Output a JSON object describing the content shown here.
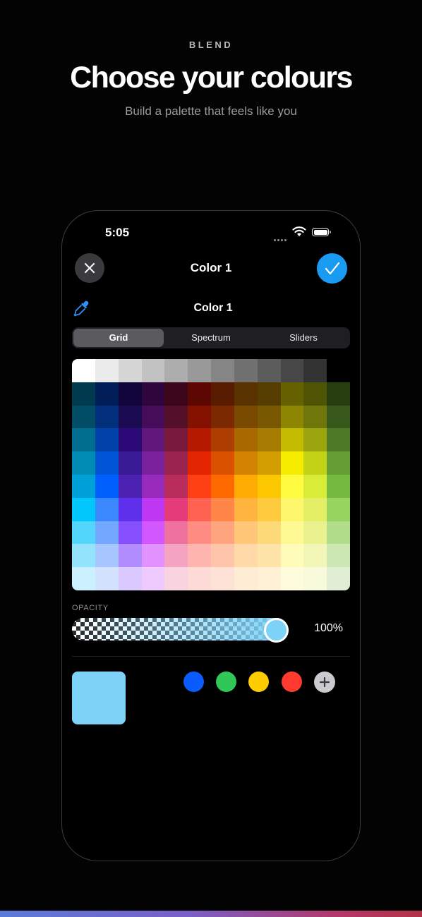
{
  "header": {
    "brand": "BLEND",
    "headline": "Choose your colours",
    "subhead": "Build a palette that feels like you"
  },
  "status_bar": {
    "time": "5:05"
  },
  "nav": {
    "title": "Color 1",
    "close_icon": "close-icon",
    "done_icon": "checkmark-icon"
  },
  "picker": {
    "title": "Color 1",
    "tool_icon": "eyedropper-icon",
    "tabs": [
      {
        "label": "Grid",
        "active": true
      },
      {
        "label": "Spectrum",
        "active": false
      },
      {
        "label": "Sliders",
        "active": false
      }
    ],
    "grid_colors": [
      [
        "#ffffff",
        "#ebebeb",
        "#d6d6d6",
        "#c2c2c2",
        "#adadad",
        "#999999",
        "#858585",
        "#707070",
        "#5c5c5c",
        "#474747",
        "#333333",
        "#000000"
      ],
      [
        "#003a4f",
        "#011d57",
        "#11053b",
        "#2e063d",
        "#3c071b",
        "#5c0701",
        "#5a1c00",
        "#583300",
        "#563d00",
        "#666100",
        "#4f5504",
        "#263e0f"
      ],
      [
        "#004d65",
        "#012f7b",
        "#1a0a52",
        "#450d59",
        "#551029",
        "#831100",
        "#7b2900",
        "#7a4a00",
        "#785800",
        "#8c8602",
        "#6f760a",
        "#38571a"
      ],
      [
        "#016e8f",
        "#0042a9",
        "#2c0977",
        "#61187c",
        "#791a3d",
        "#b51a00",
        "#ad3e00",
        "#a96800",
        "#a67b01",
        "#c4bc00",
        "#9ba50e",
        "#4e7a27"
      ],
      [
        "#008cb4",
        "#0056d6",
        "#371a94",
        "#7a219e",
        "#99244f",
        "#e22400",
        "#da5100",
        "#d38301",
        "#d19d01",
        "#f5ec00",
        "#c3d117",
        "#669d34"
      ],
      [
        "#00a1d8",
        "#0061fe",
        "#4d22b2",
        "#982abc",
        "#b92d5d",
        "#ff4015",
        "#ff6a00",
        "#ffab01",
        "#fdc700",
        "#fefb41",
        "#d9ec37",
        "#76bb40"
      ],
      [
        "#01c7fc",
        "#3a87fe",
        "#5e30eb",
        "#be38f3",
        "#e63b7a",
        "#ff6250",
        "#ff8648",
        "#feb43f",
        "#fecb3e",
        "#fff76b",
        "#e4ef65",
        "#96d35f"
      ],
      [
        "#52d6fc",
        "#74a7ff",
        "#864ffe",
        "#d357fe",
        "#ee719e",
        "#ff8c82",
        "#ffa57d",
        "#ffc777",
        "#fed977",
        "#fff994",
        "#eaf28f",
        "#b1dd8b"
      ],
      [
        "#93e3fc",
        "#a7c6ff",
        "#b18cfe",
        "#e292fe",
        "#f4a4c0",
        "#ffb5af",
        "#ffc5ab",
        "#ffd9a8",
        "#fee4a8",
        "#fffbb9",
        "#f2f7b7",
        "#cde8b5"
      ],
      [
        "#cbf0ff",
        "#d3e2ff",
        "#d9c9fe",
        "#efcaff",
        "#f9d3e0",
        "#ffdbd8",
        "#ffe2d6",
        "#ffecd4",
        "#fef1d5",
        "#fefcdd",
        "#f7fadb",
        "#dfeed4"
      ]
    ],
    "opacity": {
      "label": "OPACITY",
      "value": 1.0,
      "value_text": "100%",
      "color": "#7fd2f7"
    },
    "current_color": "#7fd2f7",
    "saved_swatches": [
      "#0a5cff",
      "#30c758",
      "#ffcc00",
      "#ff3b30"
    ],
    "add_icon": "plus-icon"
  }
}
